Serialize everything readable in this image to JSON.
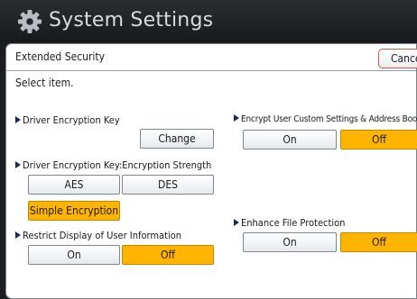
{
  "window": {
    "title": "System Settings",
    "icon": "gear-icon"
  },
  "screen": {
    "header_title": "Extended Security",
    "cancel_label": "Cancel",
    "instruction": "Select item."
  },
  "settings": {
    "driver_key": {
      "label": "Driver Encryption Key",
      "change_label": "Change"
    },
    "strength": {
      "label": "Driver Encryption Key:Encryption Strength",
      "options": [
        "AES",
        "DES",
        "Simple Encryption"
      ],
      "selected": "Simple Encryption"
    },
    "restrict_display": {
      "label": "Restrict Display of User Information",
      "on": "On",
      "off": "Off",
      "selected": "Off"
    },
    "encrypt_custom": {
      "label": "Encrypt User Custom Settings & Address Book",
      "on": "On",
      "off": "Off",
      "selected": "Off"
    },
    "file_protection": {
      "label": "Enhance File Protection",
      "on": "On",
      "off": "Off",
      "selected": "Off"
    }
  },
  "colors": {
    "selected": "#ffb400",
    "title_bar": "#1f2124",
    "cancel_border": "#d9534f"
  }
}
